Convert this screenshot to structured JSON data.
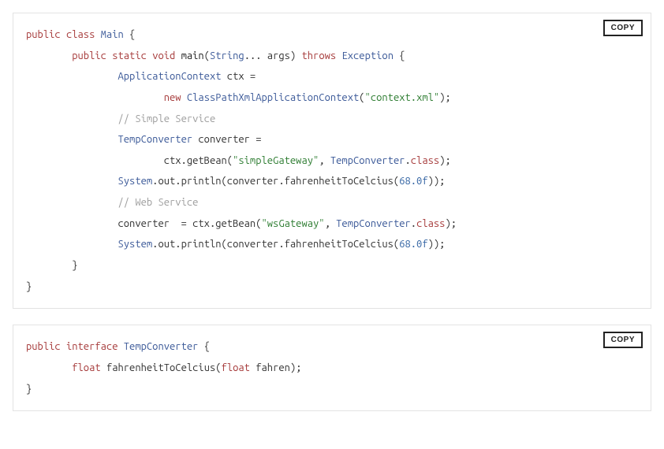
{
  "copy_label": "COPY",
  "code1": {
    "lines": [
      [
        {
          "cls": "kw",
          "t": "public"
        },
        {
          "cls": "pln",
          "t": " "
        },
        {
          "cls": "kw",
          "t": "class"
        },
        {
          "cls": "pln",
          "t": " "
        },
        {
          "cls": "type",
          "t": "Main"
        },
        {
          "cls": "pln",
          "t": " {"
        }
      ],
      [
        {
          "cls": "pln",
          "t": ""
        }
      ],
      [
        {
          "cls": "pln",
          "t": "        "
        },
        {
          "cls": "kw",
          "t": "public"
        },
        {
          "cls": "pln",
          "t": " "
        },
        {
          "cls": "kw",
          "t": "static"
        },
        {
          "cls": "pln",
          "t": " "
        },
        {
          "cls": "kw",
          "t": "void"
        },
        {
          "cls": "pln",
          "t": " "
        },
        {
          "cls": "ent",
          "t": "main"
        },
        {
          "cls": "pln",
          "t": "("
        },
        {
          "cls": "type",
          "t": "String"
        },
        {
          "cls": "pln",
          "t": "... args) "
        },
        {
          "cls": "kw",
          "t": "throws"
        },
        {
          "cls": "pln",
          "t": " "
        },
        {
          "cls": "type",
          "t": "Exception"
        },
        {
          "cls": "pln",
          "t": " {"
        }
      ],
      [
        {
          "cls": "pln",
          "t": "                "
        },
        {
          "cls": "type",
          "t": "ApplicationContext"
        },
        {
          "cls": "pln",
          "t": " ctx ="
        }
      ],
      [
        {
          "cls": "pln",
          "t": "                        "
        },
        {
          "cls": "kw",
          "t": "new"
        },
        {
          "cls": "pln",
          "t": " "
        },
        {
          "cls": "type",
          "t": "ClassPathXmlApplicationContext"
        },
        {
          "cls": "pln",
          "t": "("
        },
        {
          "cls": "str",
          "t": "\"context.xml\""
        },
        {
          "cls": "pln",
          "t": ");"
        }
      ],
      [
        {
          "cls": "pln",
          "t": "                "
        },
        {
          "cls": "cmt",
          "t": "// Simple Service"
        }
      ],
      [
        {
          "cls": "pln",
          "t": "                "
        },
        {
          "cls": "type",
          "t": "TempConverter"
        },
        {
          "cls": "pln",
          "t": " converter ="
        }
      ],
      [
        {
          "cls": "pln",
          "t": "                        ctx.getBean("
        },
        {
          "cls": "str",
          "t": "\"simpleGateway\""
        },
        {
          "cls": "pln",
          "t": ", "
        },
        {
          "cls": "type",
          "t": "TempConverter"
        },
        {
          "cls": "pln",
          "t": "."
        },
        {
          "cls": "kw",
          "t": "class"
        },
        {
          "cls": "pln",
          "t": ");"
        }
      ],
      [
        {
          "cls": "pln",
          "t": "                "
        },
        {
          "cls": "type",
          "t": "System"
        },
        {
          "cls": "pln",
          "t": ".out.println(converter.fahrenheitToCelcius("
        },
        {
          "cls": "num",
          "t": "68.0f"
        },
        {
          "cls": "pln",
          "t": "));"
        }
      ],
      [
        {
          "cls": "pln",
          "t": "                "
        },
        {
          "cls": "cmt",
          "t": "// Web Service"
        }
      ],
      [
        {
          "cls": "pln",
          "t": "                converter  = ctx.getBean("
        },
        {
          "cls": "str",
          "t": "\"wsGateway\""
        },
        {
          "cls": "pln",
          "t": ", "
        },
        {
          "cls": "type",
          "t": "TempConverter"
        },
        {
          "cls": "pln",
          "t": "."
        },
        {
          "cls": "kw",
          "t": "class"
        },
        {
          "cls": "pln",
          "t": ");"
        }
      ],
      [
        {
          "cls": "pln",
          "t": "                "
        },
        {
          "cls": "type",
          "t": "System"
        },
        {
          "cls": "pln",
          "t": ".out.println(converter.fahrenheitToCelcius("
        },
        {
          "cls": "num",
          "t": "68.0f"
        },
        {
          "cls": "pln",
          "t": "));"
        }
      ],
      [
        {
          "cls": "pln",
          "t": "        }"
        }
      ],
      [
        {
          "cls": "pln",
          "t": "}"
        }
      ]
    ]
  },
  "code2": {
    "lines": [
      [
        {
          "cls": "kw",
          "t": "public"
        },
        {
          "cls": "pln",
          "t": " "
        },
        {
          "cls": "kw",
          "t": "interface"
        },
        {
          "cls": "pln",
          "t": " "
        },
        {
          "cls": "type",
          "t": "TempConverter"
        },
        {
          "cls": "pln",
          "t": " {"
        }
      ],
      [
        {
          "cls": "pln",
          "t": ""
        }
      ],
      [
        {
          "cls": "pln",
          "t": "        "
        },
        {
          "cls": "kw",
          "t": "float"
        },
        {
          "cls": "pln",
          "t": " fahrenheitToCelcius("
        },
        {
          "cls": "kw",
          "t": "float"
        },
        {
          "cls": "pln",
          "t": " fahren);"
        }
      ],
      [
        {
          "cls": "pln",
          "t": ""
        }
      ],
      [
        {
          "cls": "pln",
          "t": "}"
        }
      ]
    ]
  }
}
